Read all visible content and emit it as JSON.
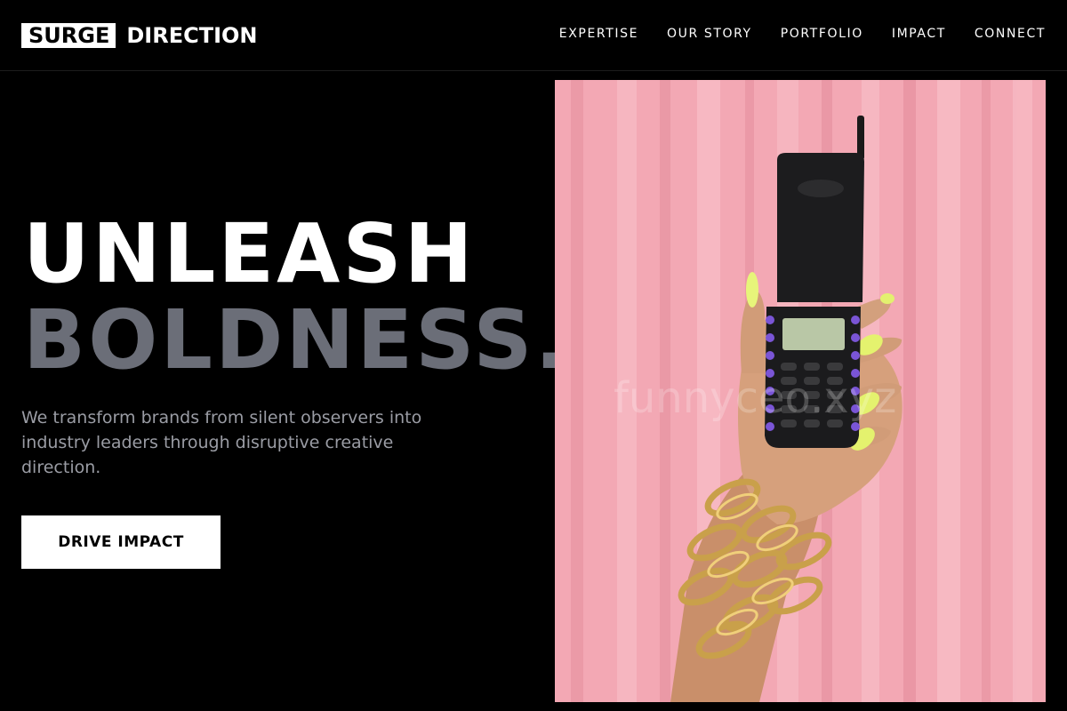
{
  "brand": {
    "box_text": "SURGE",
    "text": "DIRECTION"
  },
  "nav": {
    "items": [
      "EXPERTISE",
      "OUR STORY",
      "PORTFOLIO",
      "IMPACT",
      "CONNECT"
    ]
  },
  "hero": {
    "line1": "UNLEASH",
    "line2": "BOLDNESS.",
    "tagline": "We transform brands from silent observers into industry leaders through disruptive creative direction.",
    "cta_label": "DRIVE IMPACT"
  },
  "image": {
    "subject": "hand-holding-flip-phone-photo",
    "watermark": "funnyceo.xyz"
  },
  "colors": {
    "background": "#000000",
    "headline_primary": "#ffffff",
    "headline_secondary": "#6b6e78",
    "tagline": "#9a9ca4",
    "photo_backdrop": "#f2a6b2"
  }
}
